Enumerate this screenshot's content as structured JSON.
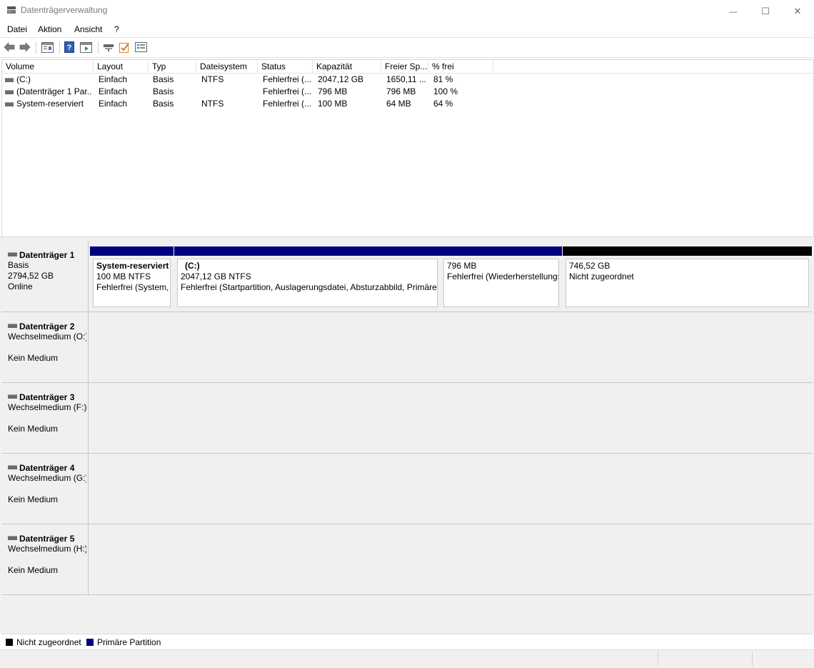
{
  "window": {
    "title": "Datenträgerverwaltung",
    "minimize_glyph": "—",
    "maximize_glyph": "☐",
    "close_glyph": "✕"
  },
  "menu": [
    {
      "label": "Datei"
    },
    {
      "label": "Aktion"
    },
    {
      "label": "Ansicht"
    },
    {
      "label": "?"
    }
  ],
  "toolbar": {
    "icons": [
      "back-arrow-icon",
      "forward-arrow-icon",
      "properties-icon",
      "help-icon",
      "show-hide-console-icon",
      "connect-disk-icon",
      "check-icon",
      "settings-list-icon"
    ]
  },
  "volume_list": {
    "columns": [
      "Volume",
      "Layout",
      "Typ",
      "Dateisystem",
      "Status",
      "Kapazität",
      "Freier Sp...",
      "% frei"
    ],
    "rows": [
      {
        "volume": "(C:)",
        "layout": "Einfach",
        "typ": "Basis",
        "fs": "NTFS",
        "status": "Fehlerfrei (...",
        "cap": "2047,12 GB",
        "free": "1650,11 ...",
        "pct": "81 %"
      },
      {
        "volume": "(Datenträger 1 Par...",
        "layout": "Einfach",
        "typ": "Basis",
        "fs": "",
        "status": "Fehlerfrei (...",
        "cap": "796 MB",
        "free": "796 MB",
        "pct": "100 %"
      },
      {
        "volume": "System-reserviert",
        "layout": "Einfach",
        "typ": "Basis",
        "fs": "NTFS",
        "status": "Fehlerfrei (...",
        "cap": "100 MB",
        "free": "64 MB",
        "pct": "64 %"
      }
    ]
  },
  "disks": [
    {
      "name": "Datenträger 1",
      "line1": "Basis",
      "line2": "2794,52 GB",
      "line3": "Online",
      "partitions": [
        {
          "title": "System-reserviert",
          "size": "100 MB NTFS",
          "status": "Fehlerfrei (System, Aktiv, Primäre Partition)"
        },
        {
          "title": "(C:)",
          "size": "2047,12 GB NTFS",
          "status": "Fehlerfrei (Startpartition, Auslagerungsdatei, Absturzabbild, Primäre Partition)"
        },
        {
          "title": "",
          "size": "796 MB",
          "status": "Fehlerfrei (Wiederherstellungspartition)"
        },
        {
          "title": "",
          "size": "746,52 GB",
          "status": "Nicht zugeordnet"
        }
      ]
    },
    {
      "name": "Datenträger 2",
      "line1": "Wechselmedium (O:)",
      "line2": "",
      "line3": "Kein Medium"
    },
    {
      "name": "Datenträger 3",
      "line1": "Wechselmedium (F:)",
      "line2": "",
      "line3": "Kein Medium"
    },
    {
      "name": "Datenträger 4",
      "line1": "Wechselmedium (G:)",
      "line2": "",
      "line3": "Kein Medium"
    },
    {
      "name": "Datenträger 5",
      "line1": "Wechselmedium (H:)",
      "line2": "",
      "line3": "Kein Medium"
    }
  ],
  "legend": {
    "unallocated": "Nicht zugeordnet",
    "primary": "Primäre Partition"
  },
  "colors": {
    "primary_partition": "#00007f",
    "unallocated": "#000000"
  }
}
